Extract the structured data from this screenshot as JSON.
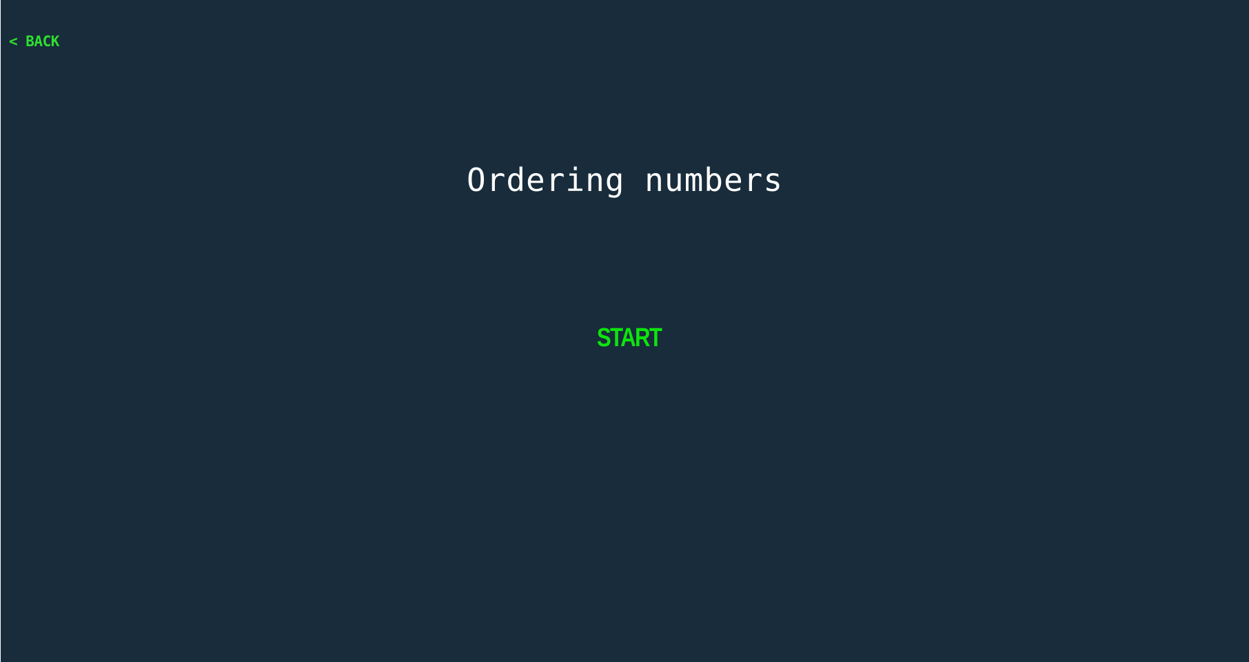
{
  "nav": {
    "back_label": "< BACK"
  },
  "game": {
    "title": "Ordering numbers",
    "start_label": "START"
  },
  "colors": {
    "background": "#182c3b",
    "accent": "#0ee40e",
    "title": "#ffffff"
  }
}
